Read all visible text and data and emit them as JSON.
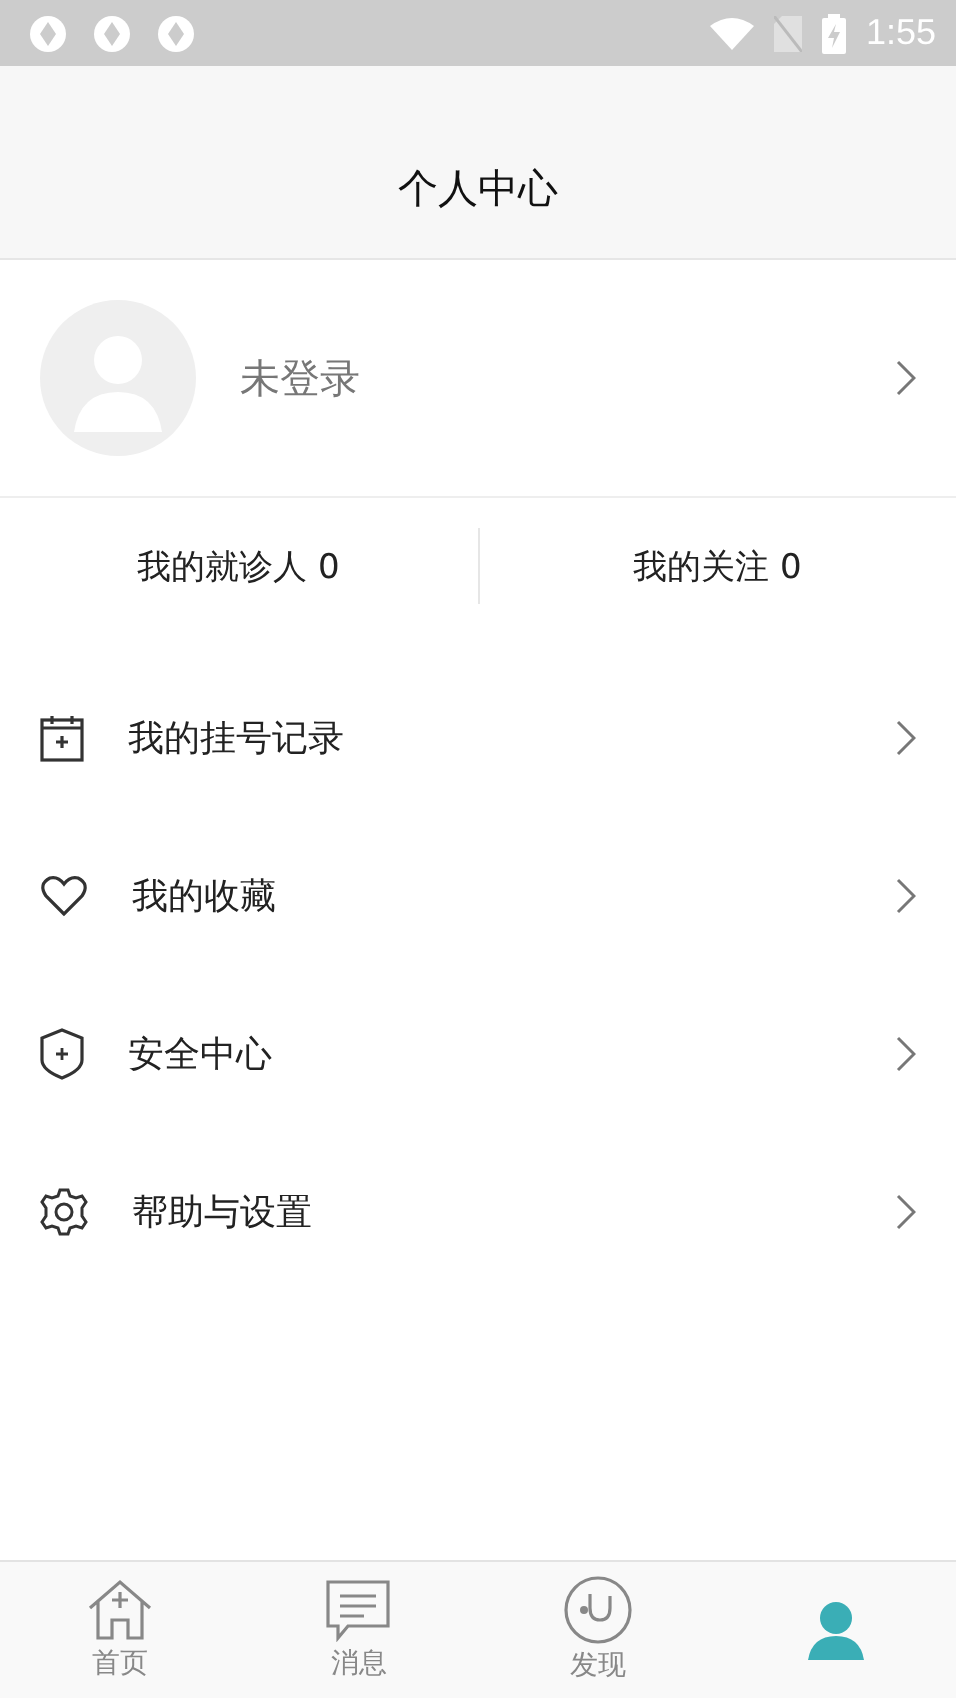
{
  "status_bar": {
    "time": "1:55"
  },
  "header": {
    "title": "个人中心"
  },
  "profile": {
    "name": "未登录"
  },
  "stats": [
    {
      "label": "我的就诊人 0"
    },
    {
      "label": "我的关注 0"
    }
  ],
  "menu": [
    {
      "kind": "calendar",
      "label": "我的挂号记录"
    },
    {
      "kind": "heart",
      "label": "我的收藏"
    },
    {
      "kind": "shield",
      "label": "安全中心"
    },
    {
      "kind": "gear",
      "label": "帮助与设置"
    }
  ],
  "tabs": [
    {
      "kind": "home",
      "label": "首页",
      "selected": false
    },
    {
      "kind": "message",
      "label": "消息",
      "selected": false
    },
    {
      "kind": "discover",
      "label": "发现",
      "selected": false
    },
    {
      "kind": "mine",
      "selected": true
    }
  ]
}
